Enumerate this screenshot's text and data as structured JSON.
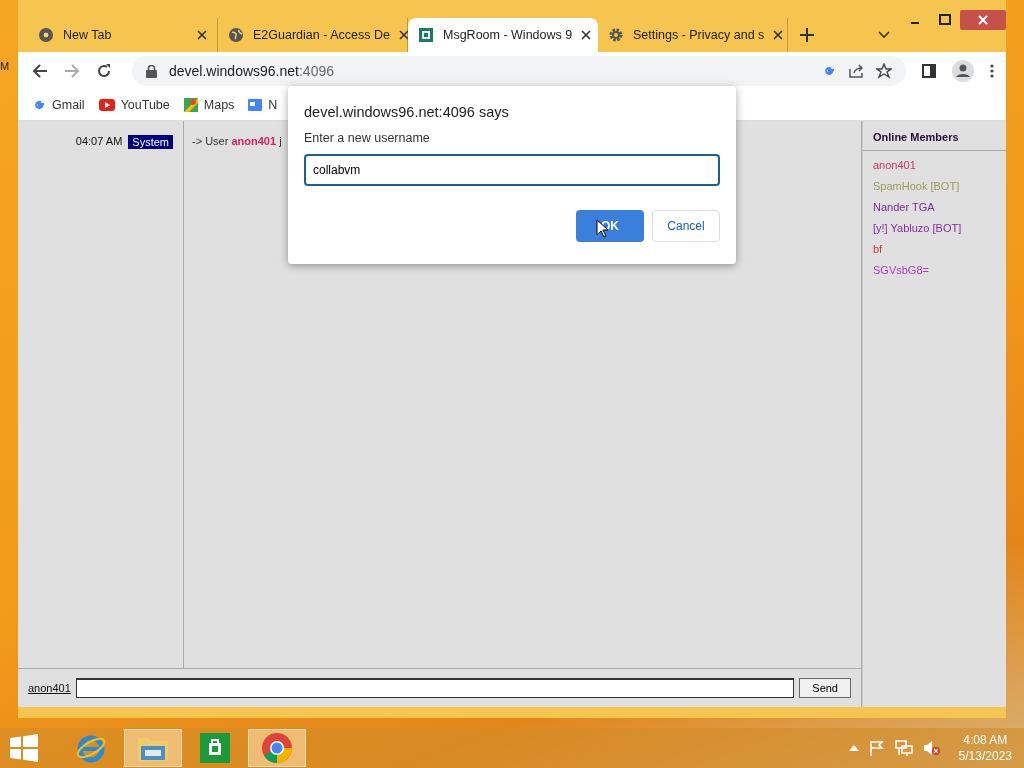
{
  "desktop": {
    "edge_label": "M"
  },
  "tabs": [
    {
      "title": "New Tab",
      "kind": "chrome",
      "selected": false
    },
    {
      "title": "E2Guardian - Access De",
      "kind": "globe",
      "selected": false
    },
    {
      "title": "MsgRoom - Windows 9",
      "kind": "app",
      "selected": true
    },
    {
      "title": "Settings - Privacy and s",
      "kind": "gear",
      "selected": false
    }
  ],
  "address": {
    "host": "devel.windows96.net",
    "rest": ":4096"
  },
  "bookmarks": [
    {
      "label": "Gmail",
      "kind": "gmail"
    },
    {
      "label": "YouTube",
      "kind": "youtube"
    },
    {
      "label": "Maps",
      "kind": "maps"
    },
    {
      "label": "N",
      "kind": "news"
    }
  ],
  "messages": [
    {
      "time": "04:07 AM",
      "sender": "System",
      "text": "-> User **anon401** j"
    }
  ],
  "members": {
    "title": "Online Members",
    "items": [
      {
        "name": "anon401",
        "color": "#c8385a"
      },
      {
        "name": "SpamHook [BOT]",
        "color": "#9a9a5a"
      },
      {
        "name": "Nander TGA",
        "color": "#7a2a9a"
      },
      {
        "name": "[y!] Yabluzo [BOT]",
        "color": "#8a2aa8"
      },
      {
        "name": "bf",
        "color": "#c83a3a"
      },
      {
        "name": "SGVsbG8=",
        "color": "#b03ac8"
      }
    ]
  },
  "composer": {
    "username": "anon401",
    "send": "Send"
  },
  "dialog": {
    "title": "devel.windows96.net:4096 says",
    "prompt": "Enter a new username",
    "value": "collabvm",
    "ok": "OK",
    "cancel": "Cancel"
  },
  "taskbar": {
    "apps": [
      {
        "kind": "ie",
        "running": false
      },
      {
        "kind": "explorer",
        "running": true
      },
      {
        "kind": "store",
        "running": false
      },
      {
        "kind": "chrome",
        "running": true
      }
    ],
    "time": "4:08 AM",
    "date": "5/13/2023"
  }
}
